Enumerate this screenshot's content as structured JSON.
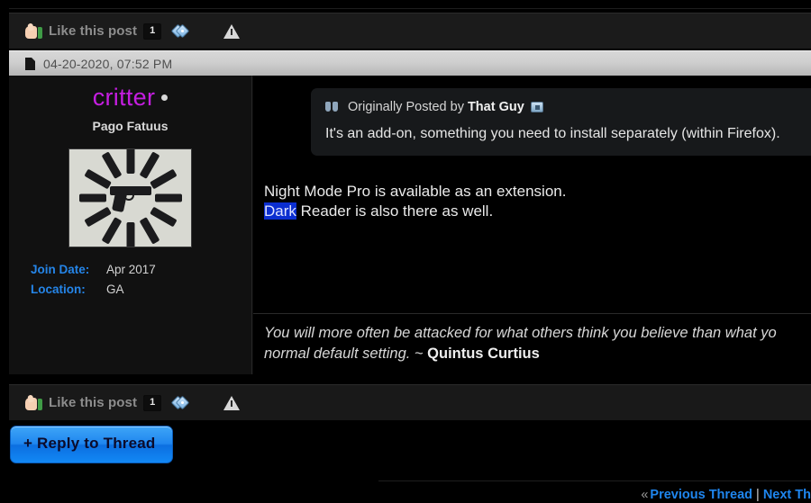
{
  "like_bar": {
    "label": "Like this post",
    "count": "1",
    "thumb_icon": "thumbs-up-icon",
    "tag_icon": "tag-icon",
    "report_icon": "warning-triangle-icon"
  },
  "post": {
    "date": "04-20-2020, 07:52 PM",
    "date_icon": "page-icon",
    "author": {
      "username": "critter",
      "online_status": "online-dot",
      "user_title": "Pago Fatuus",
      "avatar_alt": "handgun-surrounded-by-magazines",
      "fields": [
        {
          "key": "Join Date:",
          "value": "Apr 2017"
        },
        {
          "key": "Location:",
          "value": "GA"
        }
      ]
    },
    "quote": {
      "prefix": "Originally Posted by",
      "author": "That Guy",
      "quote_icon": "quote-mark-icon",
      "viewpost_icon": "view-post-icon",
      "text": "It's an add-on, something you need to install separately (within Firefox)."
    },
    "body": {
      "line1": "Night Mode Pro is available as an extension.",
      "line2_selected": "Dark",
      "line2_rest": " Reader is also there as well."
    },
    "signature": {
      "text_part1": "You will more often be attacked for what others think you believe than what yo",
      "text_part2": "normal default setting. ~ ",
      "attribution": "Quintus Curtius"
    }
  },
  "reply_button": {
    "label": "+ Reply to Thread"
  },
  "bottom_nav": {
    "chevron": "«",
    "previous": "Previous Thread",
    "separator": "|",
    "next": "Next Th"
  },
  "colors": {
    "username": "#c41ee0",
    "link": "#1f86ef",
    "field_key": "#2585e8",
    "selection": "#0b2ed0",
    "page_bg": "#000000",
    "sidebar_bg": "#111111",
    "quote_bg": "#17191b",
    "datebar_bg": "#cfcfcf"
  }
}
